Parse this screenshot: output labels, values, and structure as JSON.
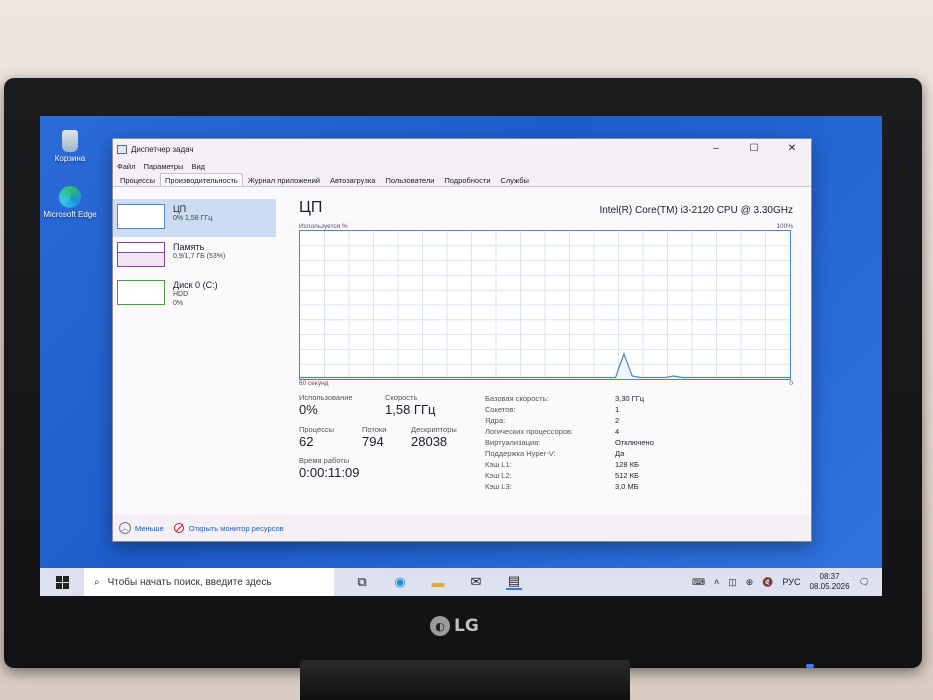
{
  "desktop": {
    "icons": [
      {
        "label": "Корзина"
      },
      {
        "label": "Microsoft Edge"
      }
    ]
  },
  "window": {
    "title": "Диспетчер задач",
    "controls": {
      "minimize": "–",
      "maximize": "☐",
      "close": "✕"
    },
    "menu": [
      "Файл",
      "Параметры",
      "Вид"
    ],
    "tabs": [
      "Процессы",
      "Производительность",
      "Журнал приложений",
      "Автозагрузка",
      "Пользователи",
      "Подробности",
      "Службы"
    ],
    "active_tab": "Производительность"
  },
  "sidebar": {
    "items": [
      {
        "title": "ЦП",
        "line1": "0%  1,58 ГГц",
        "line2": ""
      },
      {
        "title": "Память",
        "line1": "0,9/1,7 ГБ (53%)",
        "line2": ""
      },
      {
        "title": "Диск 0 (C:)",
        "line1": "HDD",
        "line2": "0%"
      }
    ]
  },
  "cpu": {
    "title": "ЦП",
    "model": "Intel(R) Core(TM) i3-2120 CPU @ 3.30GHz",
    "graph_label": "Используется %",
    "graph_max": "100%",
    "graph_time": "60 секунд",
    "graph_min": "0",
    "stats": {
      "usage_label": "Использование",
      "usage": "0%",
      "speed_label": "Скорость",
      "speed": "1,58 ГГц",
      "processes_label": "Процессы",
      "processes": "62",
      "threads_label": "Потоки",
      "threads": "794",
      "handles_label": "Дескрипторы",
      "handles": "28038",
      "uptime_label": "Время работы",
      "uptime": "0:00:11:09"
    },
    "properties": [
      {
        "k": "Базовая скорость:",
        "v": "3,30 ГГц"
      },
      {
        "k": "Сокетов:",
        "v": "1"
      },
      {
        "k": "Ядра:",
        "v": "2"
      },
      {
        "k": "Логических процессоров:",
        "v": "4"
      },
      {
        "k": "Виртуализация:",
        "v": "Отключено"
      },
      {
        "k": "Поддержка Hyper-V:",
        "v": "Да"
      },
      {
        "k": "Кэш L1:",
        "v": "128 КБ"
      },
      {
        "k": "Кэш L2:",
        "v": "512 КБ"
      },
      {
        "k": "Кэш L3:",
        "v": "3,0 МБ"
      }
    ],
    "usage_series_percent": [
      1,
      1,
      1,
      1,
      1,
      1,
      1,
      1,
      1,
      1,
      1,
      1,
      1,
      1,
      1,
      1,
      1,
      1,
      1,
      1,
      1,
      1,
      1,
      1,
      1,
      1,
      1,
      1,
      1,
      1,
      1,
      1,
      1,
      1,
      1,
      1,
      1,
      1,
      1,
      17,
      2,
      1,
      1,
      1,
      1,
      2,
      1,
      1,
      1,
      1,
      1,
      1,
      1,
      1,
      1,
      1,
      1,
      1,
      1,
      1
    ]
  },
  "footer": {
    "less": "Меньше",
    "open_monitor": "Открыть монитор ресурсов"
  },
  "taskbar": {
    "search_placeholder": "Чтобы начать поиск, введите здесь",
    "lang": "РУС",
    "time": "08:37",
    "date": "08.05.2026"
  },
  "brand": "LG",
  "colors": {
    "cpu_accent": "#4d86c7",
    "memory_accent": "#8b3f9c",
    "disk_accent": "#4b9b43",
    "desktop_bg": "#2a6bd8"
  }
}
